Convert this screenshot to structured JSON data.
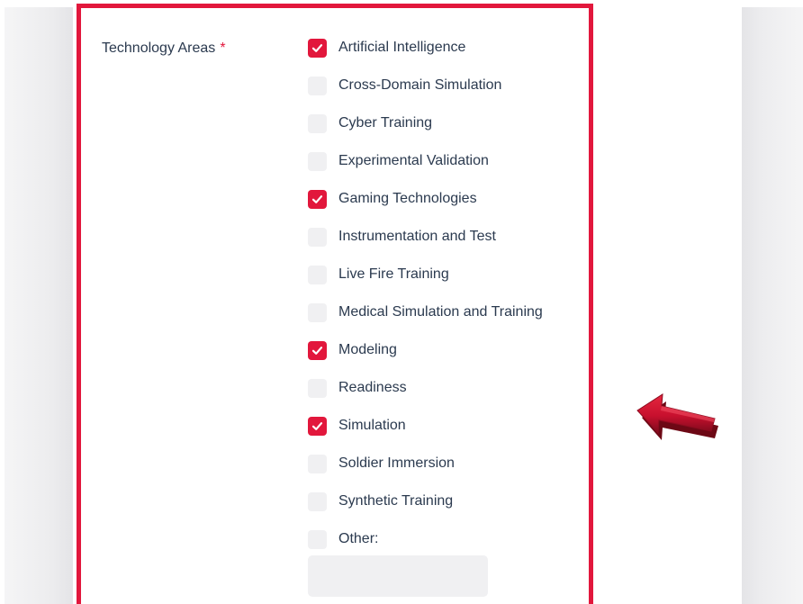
{
  "form": {
    "field_label": "Technology Areas",
    "required_marker": "*",
    "accent_color": "#e2173c",
    "options": [
      {
        "label": "Artificial Intelligence",
        "checked": true
      },
      {
        "label": "Cross-Domain Simulation",
        "checked": false
      },
      {
        "label": "Cyber Training",
        "checked": false
      },
      {
        "label": "Experimental Validation",
        "checked": false
      },
      {
        "label": "Gaming Technologies",
        "checked": true
      },
      {
        "label": "Instrumentation and Test",
        "checked": false
      },
      {
        "label": "Live Fire Training",
        "checked": false
      },
      {
        "label": "Medical Simulation and Training",
        "checked": false
      },
      {
        "label": "Modeling",
        "checked": true
      },
      {
        "label": "Readiness",
        "checked": false
      },
      {
        "label": "Simulation",
        "checked": true
      },
      {
        "label": "Soldier Immersion",
        "checked": false
      },
      {
        "label": "Synthetic Training",
        "checked": false
      },
      {
        "label": "Other:",
        "checked": false
      }
    ],
    "other_input": {
      "value": "",
      "placeholder": ""
    }
  },
  "annotation": {
    "icon": "red-arrow-left-icon",
    "color": "#c8102e"
  }
}
